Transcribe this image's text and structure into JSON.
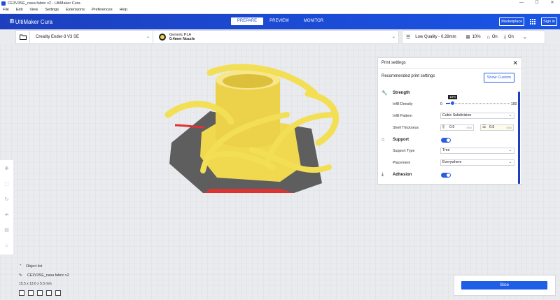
{
  "window": {
    "title": "CE3V3SE_nasa fabric v2 - UltiMaker Cura",
    "controls": [
      "—",
      "☐",
      "✕"
    ]
  },
  "menu": [
    "File",
    "Edit",
    "View",
    "Settings",
    "Extensions",
    "Preferences",
    "Help"
  ],
  "header": {
    "logo_mark": "ᗰ",
    "logo_text": "UltiMaker Cura",
    "tabs": [
      {
        "label": "PREPARE",
        "active": true
      },
      {
        "label": "PREVIEW",
        "active": false
      },
      {
        "label": "MONITOR",
        "active": false
      }
    ],
    "marketplace_label": "Marketplace",
    "signin_label": "Sign in"
  },
  "toolbar": {
    "printer": "Creality Ender-3 V3 SE",
    "material_name": "Generic PLA",
    "nozzle": "0.4mm Nozzle",
    "quality": "Low Quality - 0.28mm",
    "infill": "10%",
    "support": "On",
    "adhesion": "On"
  },
  "print_settings": {
    "title": "Print settings",
    "recommended": "Recommended print settings",
    "show_custom": "Show Custom",
    "strength": {
      "label": "Strength",
      "infill_density_label": "Infill Density",
      "infill_value": "10%",
      "infill_fraction": 0.1,
      "slider_min": "0",
      "slider_max": "100",
      "infill_pattern_label": "Infill Pattern",
      "infill_pattern": "Cubic Subdivision",
      "shell_label": "Shell Thickness",
      "wall_thickness": "0.5",
      "top_bottom_thickness": "0.5",
      "unit": "mm"
    },
    "support": {
      "label": "Support",
      "enabled": true,
      "type_label": "Support Type",
      "type": "Tree",
      "placement_label": "Placement",
      "placement": "Everywhere"
    },
    "adhesion": {
      "label": "Adhesion",
      "enabled": true
    }
  },
  "object_list": {
    "label": "Object list",
    "file": "CE3V3SE_nasa fabric v2",
    "dimensions": "15.5 x 13.6 x 5.5 mm"
  },
  "slice_label": "Slice",
  "colors": {
    "accent": "#1e5fe6",
    "model": "#f5e15a",
    "build_plate": "#5a5a5a"
  }
}
